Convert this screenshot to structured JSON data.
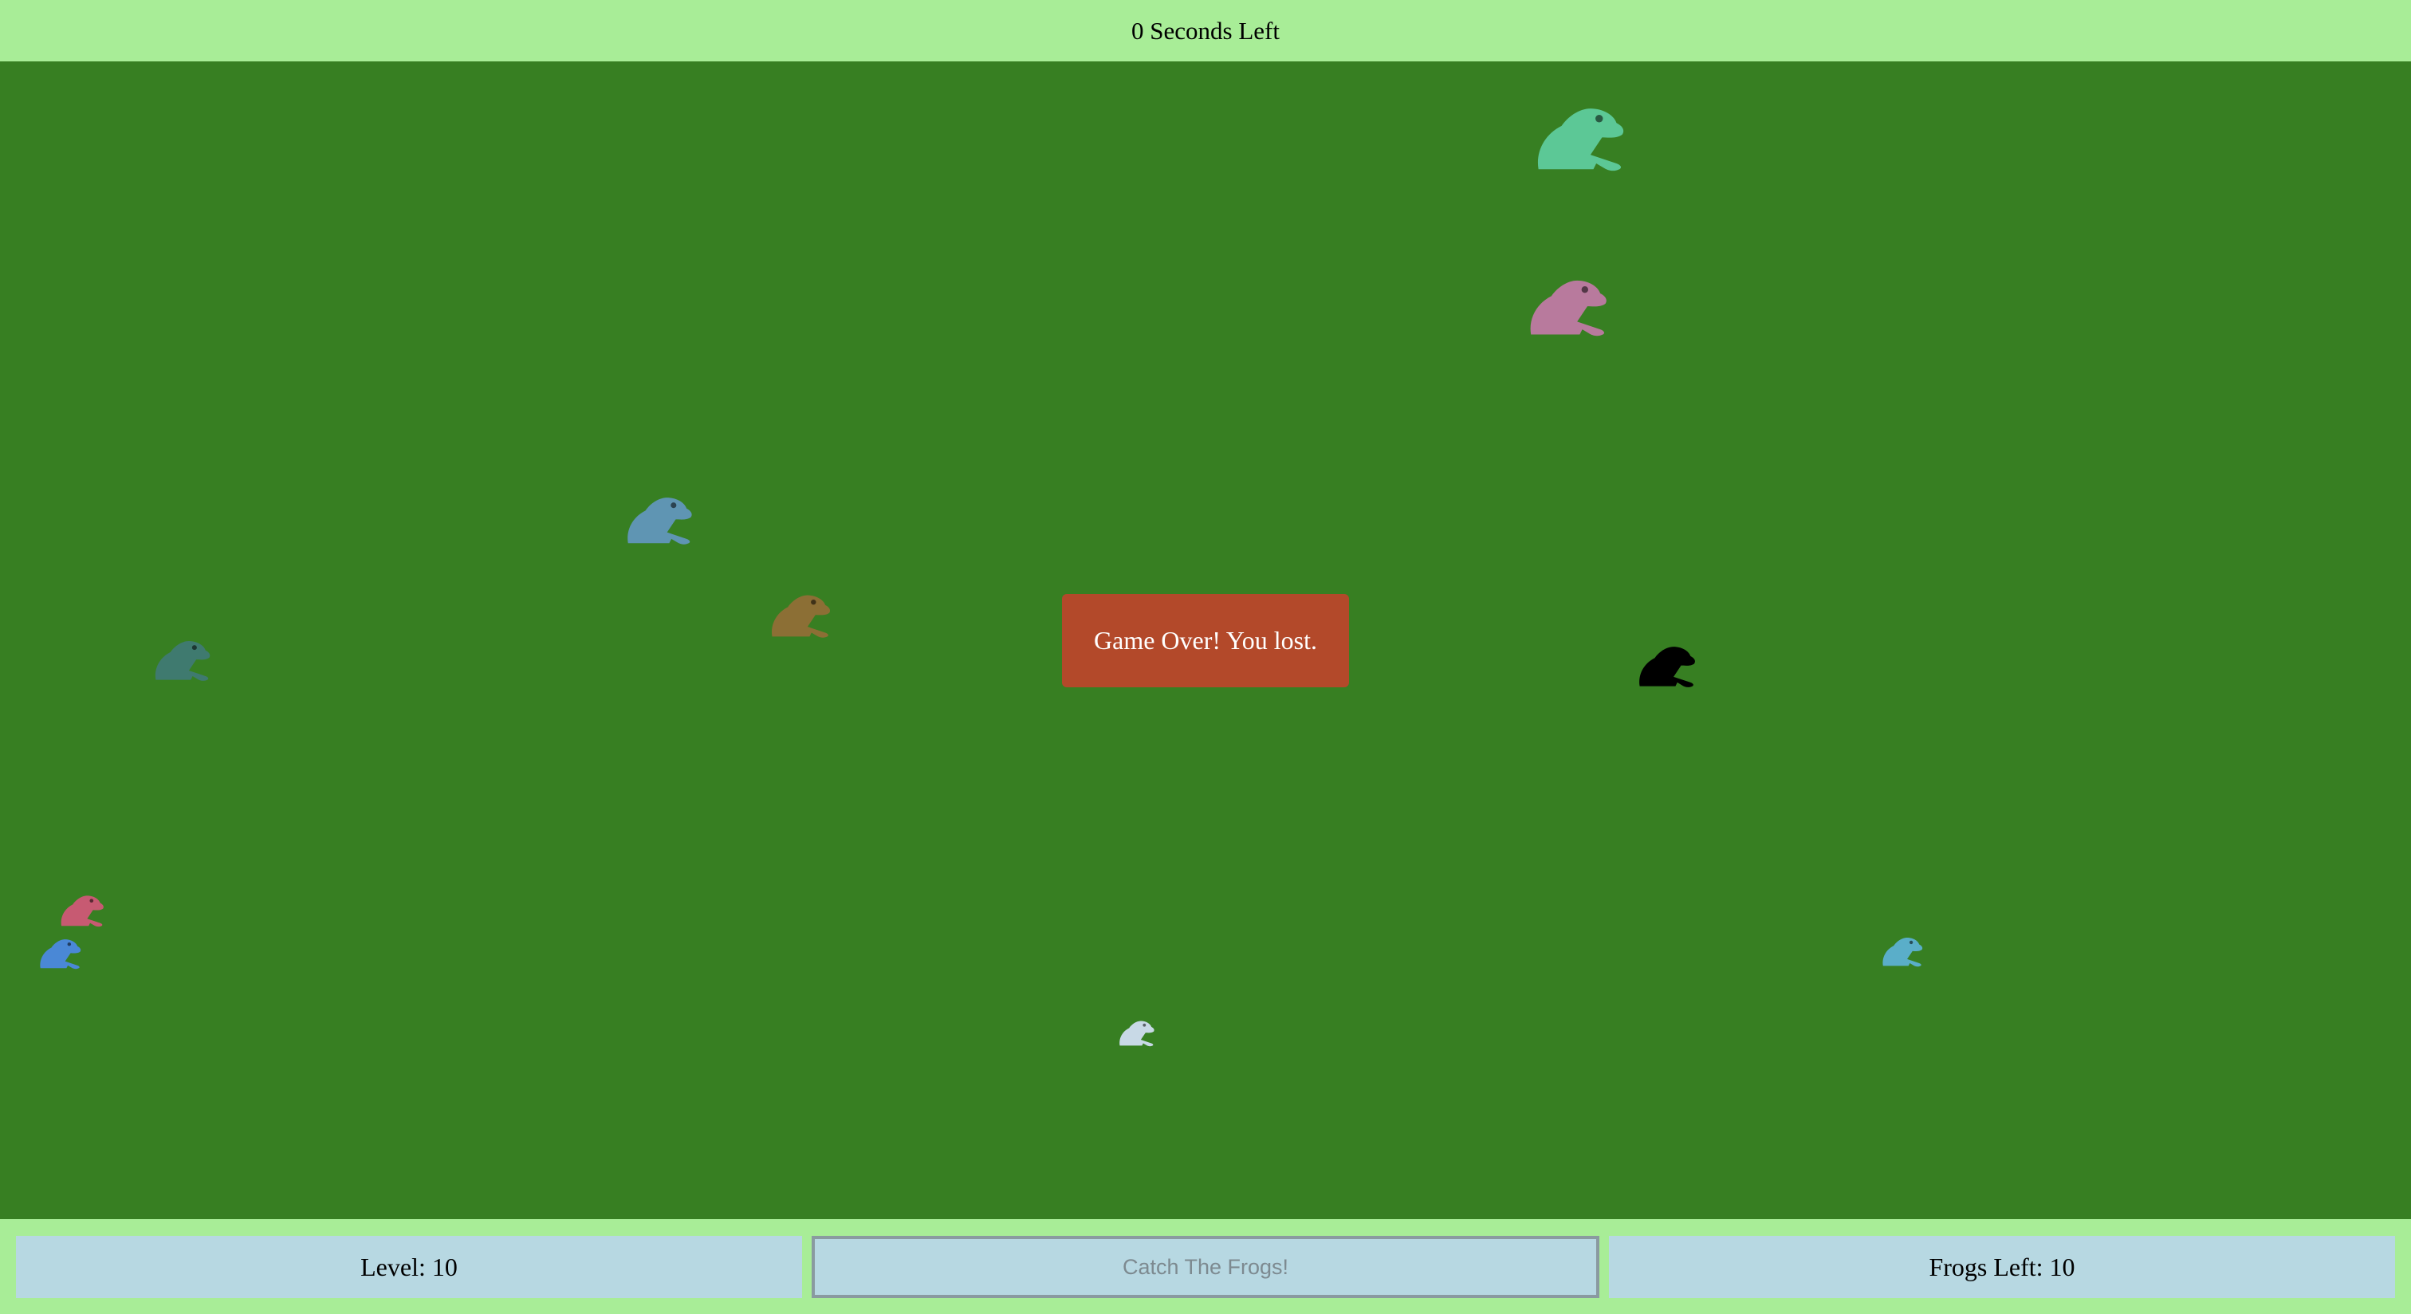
{
  "timer": {
    "text": "0 Seconds Left"
  },
  "game_over": {
    "message": "Game Over! You lost."
  },
  "controls": {
    "level_text": "Level: 10",
    "start_button_label": "Catch The Frogs!",
    "frogs_left_text": "Frogs Left: 10"
  },
  "frogs": [
    {
      "color": "#5cc896",
      "icon": "frog-icon"
    },
    {
      "color": "#b87a9d",
      "icon": "frog-icon"
    },
    {
      "color": "#5f95b3",
      "icon": "frog-icon"
    },
    {
      "color": "#8c6f35",
      "icon": "frog-icon"
    },
    {
      "color": "#3f7a6f",
      "icon": "frog-icon"
    },
    {
      "color": "#000000",
      "icon": "frog-icon"
    },
    {
      "color": "#c75a72",
      "icon": "frog-icon"
    },
    {
      "color": "#4a88d6",
      "icon": "frog-icon"
    },
    {
      "color": "#5aaec9",
      "icon": "frog-icon"
    },
    {
      "color": "#c8d9e6",
      "icon": "frog-icon"
    }
  ],
  "colors": {
    "pond": "#377f22",
    "bars": "#a8ed97",
    "panel": "#b7d8e2",
    "game_over_bg": "#b3492a"
  }
}
